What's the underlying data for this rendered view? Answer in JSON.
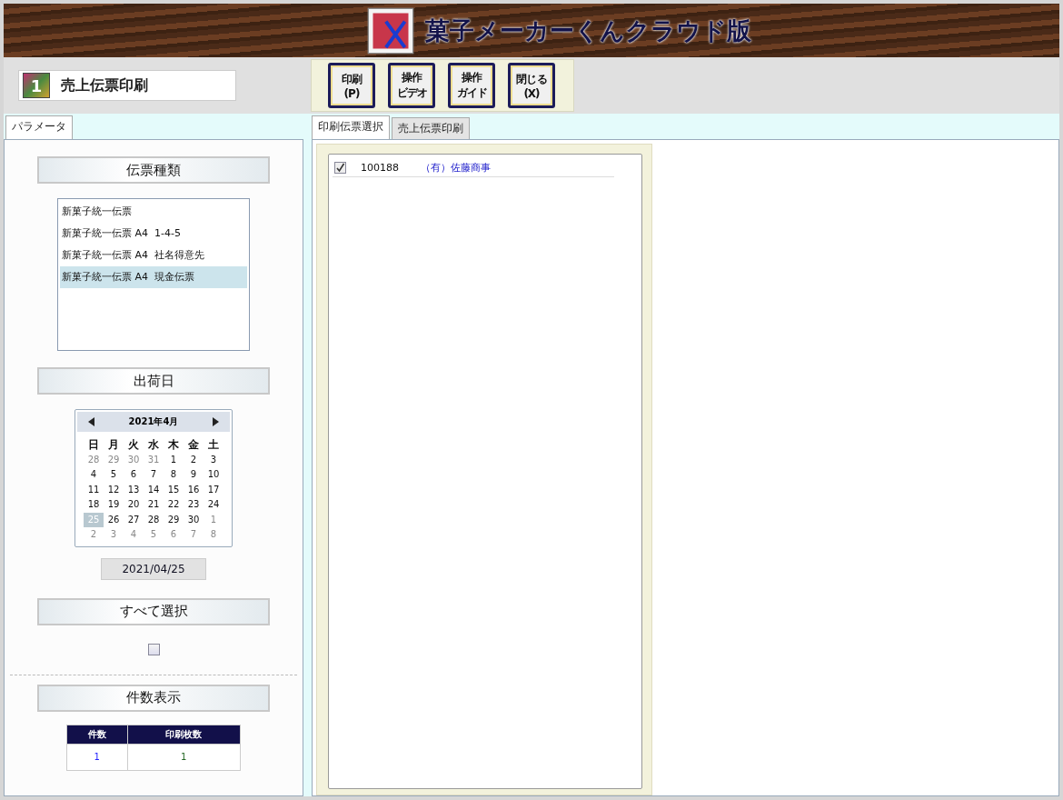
{
  "header": {
    "title": "菓子メーカーくんクラウド版"
  },
  "screen": {
    "number_badge": "1",
    "title": "売上伝票印刷"
  },
  "toolbar": [
    {
      "label": "印刷",
      "key": "(P)"
    },
    {
      "label": "操作",
      "key": "ビデオ"
    },
    {
      "label": "操作",
      "key": "ガイド"
    },
    {
      "label": "閉じる",
      "key": "(X)"
    }
  ],
  "left_tabs": [
    {
      "label": "パラメータ",
      "selected": true
    }
  ],
  "slip_types": {
    "heading": "伝票種類",
    "items": [
      {
        "label": "新菓子統一伝票",
        "selected": false
      },
      {
        "label": "新菓子統一伝票 A4  1-4-5",
        "selected": false
      },
      {
        "label": "新菓子統一伝票 A4  社名得意先",
        "selected": false
      },
      {
        "label": "新菓子統一伝票 A4  現金伝票",
        "selected": true
      }
    ]
  },
  "ship_date": {
    "heading": "出荷日",
    "calendar": {
      "month": "2021年4月",
      "weekdays": [
        "日",
        "月",
        "火",
        "水",
        "木",
        "金",
        "土"
      ],
      "weeks": [
        [
          {
            "d": "28",
            "muted": true,
            "selected": false
          },
          {
            "d": "29",
            "muted": true,
            "selected": false
          },
          {
            "d": "30",
            "muted": true,
            "selected": false
          },
          {
            "d": "31",
            "muted": true,
            "selected": false
          },
          {
            "d": "1",
            "muted": false,
            "selected": false
          },
          {
            "d": "2",
            "muted": false,
            "selected": false
          },
          {
            "d": "3",
            "muted": false,
            "selected": false
          }
        ],
        [
          {
            "d": "4",
            "muted": false,
            "selected": false
          },
          {
            "d": "5",
            "muted": false,
            "selected": false
          },
          {
            "d": "6",
            "muted": false,
            "selected": false
          },
          {
            "d": "7",
            "muted": false,
            "selected": false
          },
          {
            "d": "8",
            "muted": false,
            "selected": false
          },
          {
            "d": "9",
            "muted": false,
            "selected": false
          },
          {
            "d": "10",
            "muted": false,
            "selected": false
          }
        ],
        [
          {
            "d": "11",
            "muted": false,
            "selected": false
          },
          {
            "d": "12",
            "muted": false,
            "selected": false
          },
          {
            "d": "13",
            "muted": false,
            "selected": false
          },
          {
            "d": "14",
            "muted": false,
            "selected": false
          },
          {
            "d": "15",
            "muted": false,
            "selected": false
          },
          {
            "d": "16",
            "muted": false,
            "selected": false
          },
          {
            "d": "17",
            "muted": false,
            "selected": false
          }
        ],
        [
          {
            "d": "18",
            "muted": false,
            "selected": false
          },
          {
            "d": "19",
            "muted": false,
            "selected": false
          },
          {
            "d": "20",
            "muted": false,
            "selected": false
          },
          {
            "d": "21",
            "muted": false,
            "selected": false
          },
          {
            "d": "22",
            "muted": false,
            "selected": false
          },
          {
            "d": "23",
            "muted": false,
            "selected": false
          },
          {
            "d": "24",
            "muted": false,
            "selected": false
          }
        ],
        [
          {
            "d": "25",
            "muted": false,
            "selected": true
          },
          {
            "d": "26",
            "muted": false,
            "selected": false
          },
          {
            "d": "27",
            "muted": false,
            "selected": false
          },
          {
            "d": "28",
            "muted": false,
            "selected": false
          },
          {
            "d": "29",
            "muted": false,
            "selected": false
          },
          {
            "d": "30",
            "muted": false,
            "selected": false
          },
          {
            "d": "1",
            "muted": true,
            "selected": false
          }
        ],
        [
          {
            "d": "2",
            "muted": true,
            "selected": false
          },
          {
            "d": "3",
            "muted": true,
            "selected": false
          },
          {
            "d": "4",
            "muted": true,
            "selected": false
          },
          {
            "d": "5",
            "muted": true,
            "selected": false
          },
          {
            "d": "6",
            "muted": true,
            "selected": false
          },
          {
            "d": "7",
            "muted": true,
            "selected": false
          },
          {
            "d": "8",
            "muted": true,
            "selected": false
          }
        ]
      ]
    },
    "value": "2021/04/25"
  },
  "select_all": {
    "heading": "すべて選択",
    "checked": false
  },
  "counts": {
    "heading": "件数表示",
    "columns": [
      "件数",
      "印刷枚数"
    ],
    "values": [
      "1",
      "1"
    ]
  },
  "right_tabs": [
    {
      "label": "印刷伝票選択",
      "selected": true
    },
    {
      "label": "売上伝票印刷",
      "selected": false
    }
  ],
  "slips": [
    {
      "checked": true,
      "number": "100188",
      "customer": "（有）佐藤商事"
    }
  ]
}
